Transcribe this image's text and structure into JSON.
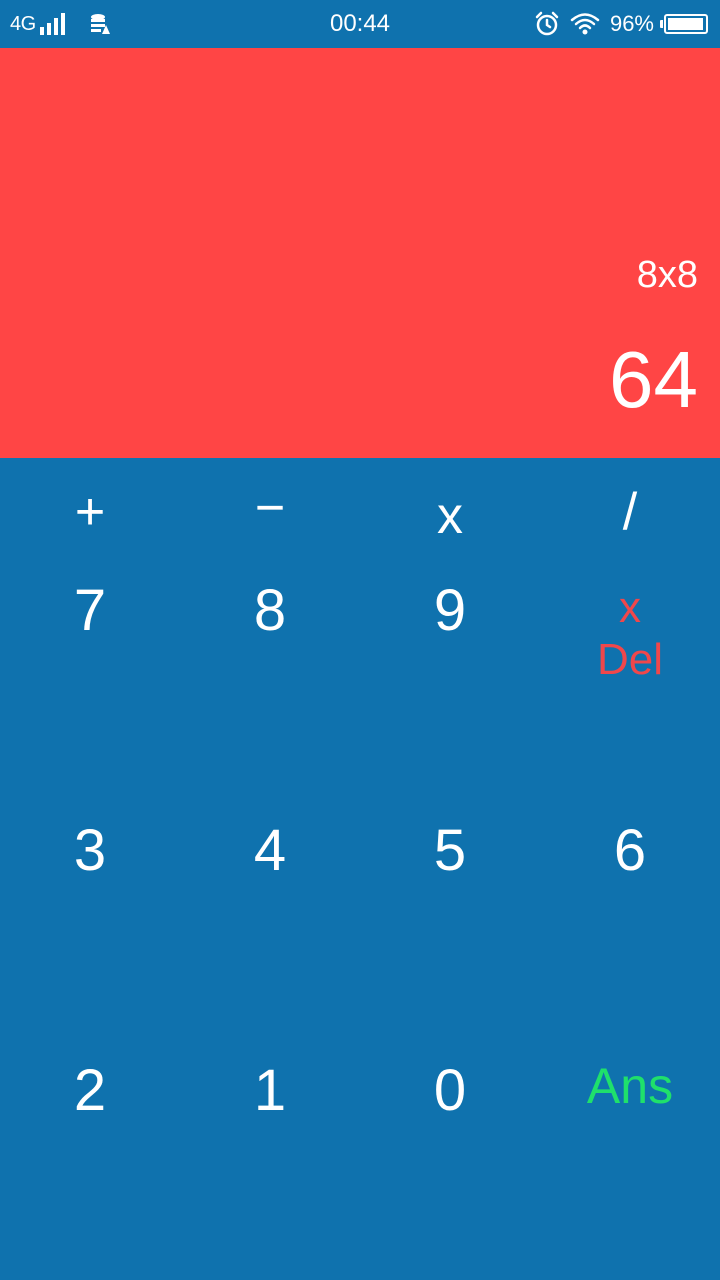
{
  "status_bar": {
    "network": "4G",
    "time": "00:44",
    "battery_percent": "96%",
    "battery_level": 0.96,
    "icons": [
      "signal-icon",
      "data-sync-icon",
      "alarm-icon",
      "wifi-icon",
      "battery-icon"
    ]
  },
  "display": {
    "expression": "8x8",
    "result": "64",
    "background_color": "#ff4545"
  },
  "keypad": {
    "operators": [
      "+",
      "−",
      "x",
      "/"
    ],
    "row1": [
      "7",
      "8",
      "9"
    ],
    "delete": {
      "symbol": "x",
      "label": "Del",
      "color": "#f0474b"
    },
    "row2": [
      "3",
      "4",
      "5",
      "6"
    ],
    "row3": [
      "2",
      "1",
      "0"
    ],
    "answer": {
      "label": "Ans",
      "color": "#1fe06b"
    },
    "background_color": "#0f72ae"
  }
}
